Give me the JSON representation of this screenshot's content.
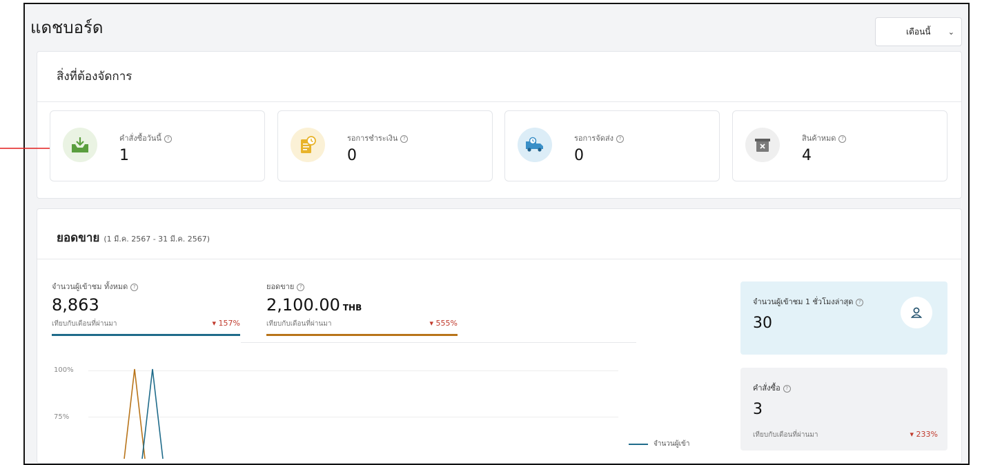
{
  "dashboard": {
    "title": "แดชบอร์ด",
    "period_select": "เดือนนี้"
  },
  "todo": {
    "title": "สิ่งที่ต้องจัดการ",
    "tiles": [
      {
        "label": "คำสั่งซื้อวันนี้",
        "value": "1",
        "icon": "inbox-download-icon",
        "color": "#5a9e3e"
      },
      {
        "label": "รอการชำระเงิน",
        "value": "0",
        "icon": "invoice-clock-icon",
        "color": "#e8b32a"
      },
      {
        "label": "รอการจัดส่ง",
        "value": "0",
        "icon": "delivery-truck-icon",
        "color": "#3a8fc7"
      },
      {
        "label": "สินค้าหมด",
        "value": "4",
        "icon": "empty-box-icon",
        "color": "#7a7a7a"
      }
    ]
  },
  "sales": {
    "title": "ยอดขาย",
    "range": "(1 มี.ค. 2567 - 31 มี.ค. 2567)",
    "metrics": [
      {
        "label": "จำนวนผู้เข้าชม ทั้งหมด",
        "value": "8,863",
        "unit": "",
        "compare": "เทียบกับเดือนที่ผ่านมา",
        "delta": "▾ 157%",
        "color": "#1f6b8a"
      },
      {
        "label": "ยอดขาย",
        "value": "2,100.00",
        "unit": "THB",
        "compare": "เทียบกับเดือนที่ผ่านมา",
        "delta": "▾ 555%",
        "color": "#b8741a"
      }
    ],
    "axis": [
      "100%",
      "75%"
    ],
    "legend": "จำนวนผู้เข้า",
    "side": [
      {
        "label": "จำนวนผู้เข้าชม 1 ชั่วโมงล่าสุด",
        "value": "30"
      },
      {
        "label": "คำสั่งซื้อ",
        "value": "3",
        "compare": "เทียบกับเดือนที่ผ่านมา",
        "delta": "▾ 233%"
      }
    ]
  }
}
